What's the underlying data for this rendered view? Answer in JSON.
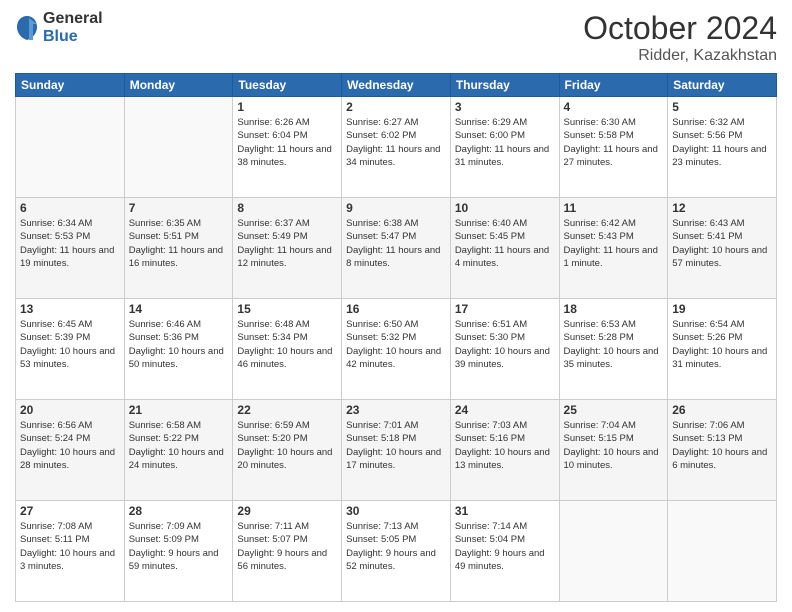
{
  "logo": {
    "general": "General",
    "blue": "Blue"
  },
  "header": {
    "month_title": "October 2024",
    "location": "Ridder, Kazakhstan"
  },
  "weekdays": [
    "Sunday",
    "Monday",
    "Tuesday",
    "Wednesday",
    "Thursday",
    "Friday",
    "Saturday"
  ],
  "weeks": [
    [
      {
        "day": "",
        "info": ""
      },
      {
        "day": "",
        "info": ""
      },
      {
        "day": "1",
        "info": "Sunrise: 6:26 AM\nSunset: 6:04 PM\nDaylight: 11 hours and 38 minutes."
      },
      {
        "day": "2",
        "info": "Sunrise: 6:27 AM\nSunset: 6:02 PM\nDaylight: 11 hours and 34 minutes."
      },
      {
        "day": "3",
        "info": "Sunrise: 6:29 AM\nSunset: 6:00 PM\nDaylight: 11 hours and 31 minutes."
      },
      {
        "day": "4",
        "info": "Sunrise: 6:30 AM\nSunset: 5:58 PM\nDaylight: 11 hours and 27 minutes."
      },
      {
        "day": "5",
        "info": "Sunrise: 6:32 AM\nSunset: 5:56 PM\nDaylight: 11 hours and 23 minutes."
      }
    ],
    [
      {
        "day": "6",
        "info": "Sunrise: 6:34 AM\nSunset: 5:53 PM\nDaylight: 11 hours and 19 minutes."
      },
      {
        "day": "7",
        "info": "Sunrise: 6:35 AM\nSunset: 5:51 PM\nDaylight: 11 hours and 16 minutes."
      },
      {
        "day": "8",
        "info": "Sunrise: 6:37 AM\nSunset: 5:49 PM\nDaylight: 11 hours and 12 minutes."
      },
      {
        "day": "9",
        "info": "Sunrise: 6:38 AM\nSunset: 5:47 PM\nDaylight: 11 hours and 8 minutes."
      },
      {
        "day": "10",
        "info": "Sunrise: 6:40 AM\nSunset: 5:45 PM\nDaylight: 11 hours and 4 minutes."
      },
      {
        "day": "11",
        "info": "Sunrise: 6:42 AM\nSunset: 5:43 PM\nDaylight: 11 hours and 1 minute."
      },
      {
        "day": "12",
        "info": "Sunrise: 6:43 AM\nSunset: 5:41 PM\nDaylight: 10 hours and 57 minutes."
      }
    ],
    [
      {
        "day": "13",
        "info": "Sunrise: 6:45 AM\nSunset: 5:39 PM\nDaylight: 10 hours and 53 minutes."
      },
      {
        "day": "14",
        "info": "Sunrise: 6:46 AM\nSunset: 5:36 PM\nDaylight: 10 hours and 50 minutes."
      },
      {
        "day": "15",
        "info": "Sunrise: 6:48 AM\nSunset: 5:34 PM\nDaylight: 10 hours and 46 minutes."
      },
      {
        "day": "16",
        "info": "Sunrise: 6:50 AM\nSunset: 5:32 PM\nDaylight: 10 hours and 42 minutes."
      },
      {
        "day": "17",
        "info": "Sunrise: 6:51 AM\nSunset: 5:30 PM\nDaylight: 10 hours and 39 minutes."
      },
      {
        "day": "18",
        "info": "Sunrise: 6:53 AM\nSunset: 5:28 PM\nDaylight: 10 hours and 35 minutes."
      },
      {
        "day": "19",
        "info": "Sunrise: 6:54 AM\nSunset: 5:26 PM\nDaylight: 10 hours and 31 minutes."
      }
    ],
    [
      {
        "day": "20",
        "info": "Sunrise: 6:56 AM\nSunset: 5:24 PM\nDaylight: 10 hours and 28 minutes."
      },
      {
        "day": "21",
        "info": "Sunrise: 6:58 AM\nSunset: 5:22 PM\nDaylight: 10 hours and 24 minutes."
      },
      {
        "day": "22",
        "info": "Sunrise: 6:59 AM\nSunset: 5:20 PM\nDaylight: 10 hours and 20 minutes."
      },
      {
        "day": "23",
        "info": "Sunrise: 7:01 AM\nSunset: 5:18 PM\nDaylight: 10 hours and 17 minutes."
      },
      {
        "day": "24",
        "info": "Sunrise: 7:03 AM\nSunset: 5:16 PM\nDaylight: 10 hours and 13 minutes."
      },
      {
        "day": "25",
        "info": "Sunrise: 7:04 AM\nSunset: 5:15 PM\nDaylight: 10 hours and 10 minutes."
      },
      {
        "day": "26",
        "info": "Sunrise: 7:06 AM\nSunset: 5:13 PM\nDaylight: 10 hours and 6 minutes."
      }
    ],
    [
      {
        "day": "27",
        "info": "Sunrise: 7:08 AM\nSunset: 5:11 PM\nDaylight: 10 hours and 3 minutes."
      },
      {
        "day": "28",
        "info": "Sunrise: 7:09 AM\nSunset: 5:09 PM\nDaylight: 9 hours and 59 minutes."
      },
      {
        "day": "29",
        "info": "Sunrise: 7:11 AM\nSunset: 5:07 PM\nDaylight: 9 hours and 56 minutes."
      },
      {
        "day": "30",
        "info": "Sunrise: 7:13 AM\nSunset: 5:05 PM\nDaylight: 9 hours and 52 minutes."
      },
      {
        "day": "31",
        "info": "Sunrise: 7:14 AM\nSunset: 5:04 PM\nDaylight: 9 hours and 49 minutes."
      },
      {
        "day": "",
        "info": ""
      },
      {
        "day": "",
        "info": ""
      }
    ]
  ]
}
